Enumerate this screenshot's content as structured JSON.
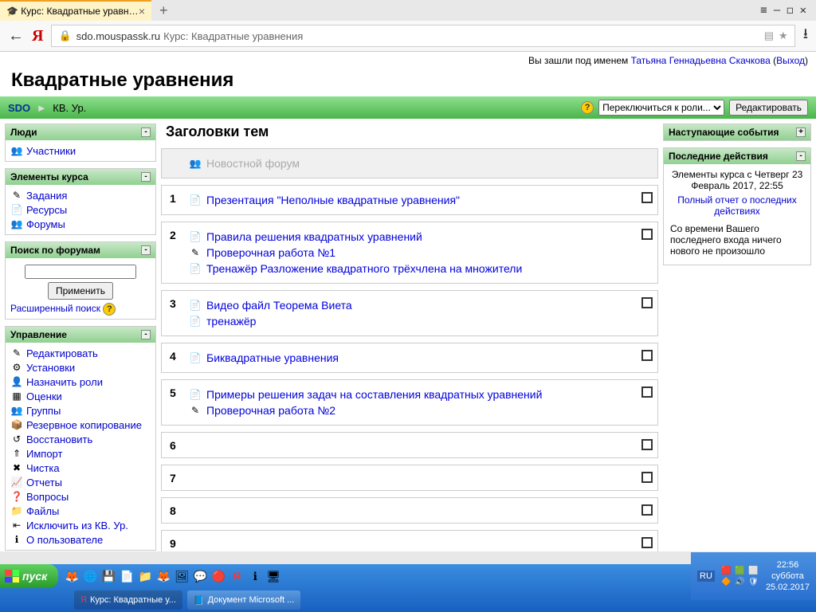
{
  "browser": {
    "tab_title": "Курс: Квадратные уравн…",
    "domain": "sdo.mouspassk.ru",
    "title_sep": "Курс: Квадратные уравнения"
  },
  "login": {
    "prefix": "Вы зашли под именем ",
    "user": "Татьяна Геннадьевна Скачкова",
    "logout": "Выход"
  },
  "header": "Квадратные уравнения",
  "breadcrumb": {
    "home": "SDO",
    "sep": "►",
    "current": "КВ. Ур."
  },
  "navbar": {
    "role_select": "Переключиться к роли...",
    "edit": "Редактировать"
  },
  "blocks": {
    "people": {
      "title": "Люди",
      "items": [
        "Участники"
      ]
    },
    "course_elements": {
      "title": "Элементы курса",
      "items": [
        "Задания",
        "Ресурсы",
        "Форумы"
      ]
    },
    "search": {
      "title": "Поиск по форумам",
      "button": "Применить",
      "advanced": "Расширенный поиск"
    },
    "admin": {
      "title": "Управление",
      "items": [
        "Редактировать",
        "Установки",
        "Назначить роли",
        "Оценки",
        "Группы",
        "Резервное копирование",
        "Восстановить",
        "Импорт",
        "Чистка",
        "Отчеты",
        "Вопросы",
        "Файлы",
        "Исключить из КВ. Ур.",
        "О пользователе"
      ]
    },
    "upcoming": {
      "title": "Наступающие события"
    },
    "recent": {
      "title": "Последние действия",
      "since": "Элементы курса с Четверг 23 Февраль 2017, 22:55",
      "report": "Полный отчет о последних действиях",
      "none": "Со времени Вашего последнего входа ничего нового не произошло"
    }
  },
  "topics": {
    "heading": "Заголовки тем",
    "rows": [
      {
        "num": "",
        "items": [
          {
            "label": "Новостной форум",
            "dimmed": true,
            "icon": "👥"
          }
        ]
      },
      {
        "num": "1",
        "items": [
          {
            "label": "Презентация \"Неполные квадратные уравнения\"",
            "icon": "📄"
          }
        ]
      },
      {
        "num": "2",
        "items": [
          {
            "label": "Правила решения квадратных уравнений",
            "icon": "📄"
          },
          {
            "label": "Проверочная работа №1",
            "icon": "✎"
          },
          {
            "label": "Тренажёр Разложение квадратного трёхчлена на множители",
            "icon": "📄"
          }
        ]
      },
      {
        "num": "3",
        "items": [
          {
            "label": "Видео файл Теорема Виета",
            "icon": "📄"
          },
          {
            "label": "тренажёр",
            "icon": "📄"
          }
        ]
      },
      {
        "num": "4",
        "items": [
          {
            "label": "Биквадратные уравнения",
            "icon": "📄"
          }
        ]
      },
      {
        "num": "5",
        "items": [
          {
            "label": "Примеры решения задач на составления квадратных уравнений",
            "icon": "📄"
          },
          {
            "label": "Проверочная работа №2",
            "icon": "✎"
          }
        ]
      },
      {
        "num": "6",
        "items": []
      },
      {
        "num": "7",
        "items": []
      },
      {
        "num": "8",
        "items": []
      },
      {
        "num": "9",
        "items": []
      }
    ]
  },
  "taskbar": {
    "start": "пуск",
    "tasks": [
      "Курс: Квадратные у...",
      "Документ Microsoft ..."
    ],
    "lang": "RU",
    "clock": {
      "time": "22:56",
      "day": "суббота",
      "date": "25.02.2017"
    }
  },
  "admin_icons": [
    "✎",
    "⚙",
    "👤",
    "▦",
    "👥",
    "📦",
    "↺",
    "⇑",
    "✖",
    "📈",
    "❓",
    "📁",
    "⇤",
    "ℹ"
  ]
}
